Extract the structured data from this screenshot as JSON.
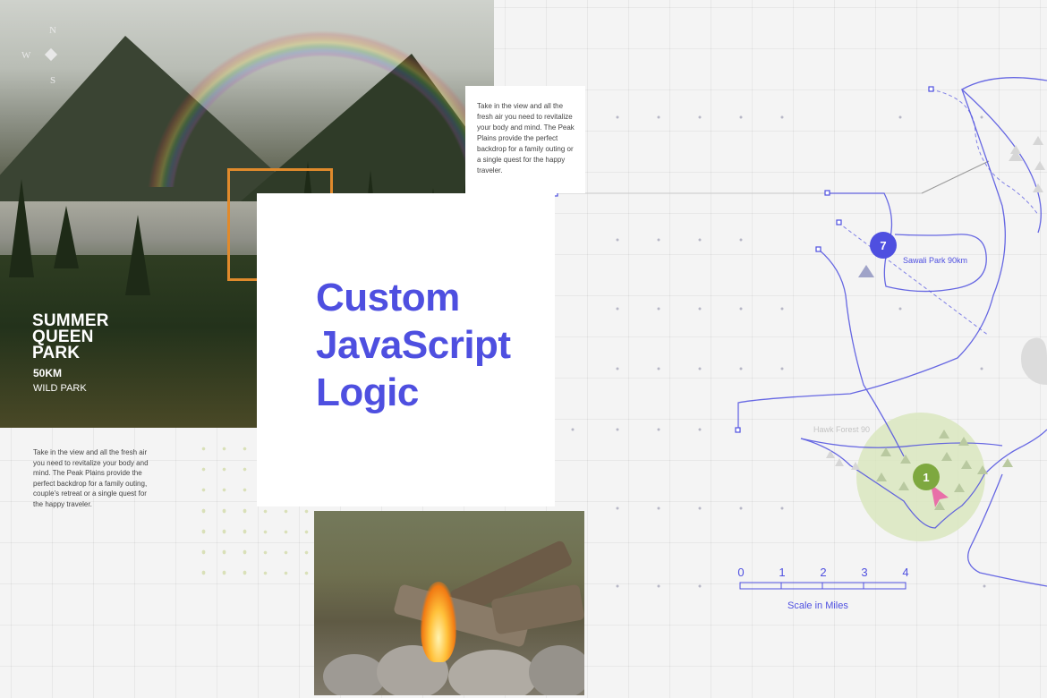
{
  "colors": {
    "accent": "#4e4fe0",
    "orange": "#e08a2c",
    "green_zone": "#d8e6bb",
    "marker_green": "#7ea83f",
    "cursor_pink": "#e86fa8"
  },
  "compass": {
    "n": "N",
    "w": "W",
    "s": "S"
  },
  "park": {
    "title_lines": [
      "SUMMER",
      "QUEEN",
      "PARK"
    ],
    "distance": "50KM",
    "type": "WILD PARK"
  },
  "card_text": "Take in the view and all the fresh air you need to revitalize your body and mind. The Peak Plains provide the perfect backdrop for a family outing or a single quest for the happy traveler.",
  "body_text": "Take in the view and all the fresh air you need to revitalize your body and mind. The Peak Plains provide the perfect backdrop for a family outing, couple's retreat or a single quest for the happy traveler.",
  "heading": {
    "lines": [
      "Custom",
      "JavaScript",
      "Logic"
    ]
  },
  "map": {
    "markers": [
      {
        "number": "7",
        "label": "Sawali Park 90km"
      },
      {
        "number": "1",
        "label": "Hawk Forest 90"
      }
    ],
    "scale": {
      "ticks": [
        "0",
        "1",
        "2",
        "3",
        "4"
      ],
      "label": "Scale in Miles"
    },
    "icons": [
      "tree-icon",
      "mountain-icon",
      "cursor-arrow-icon"
    ]
  }
}
